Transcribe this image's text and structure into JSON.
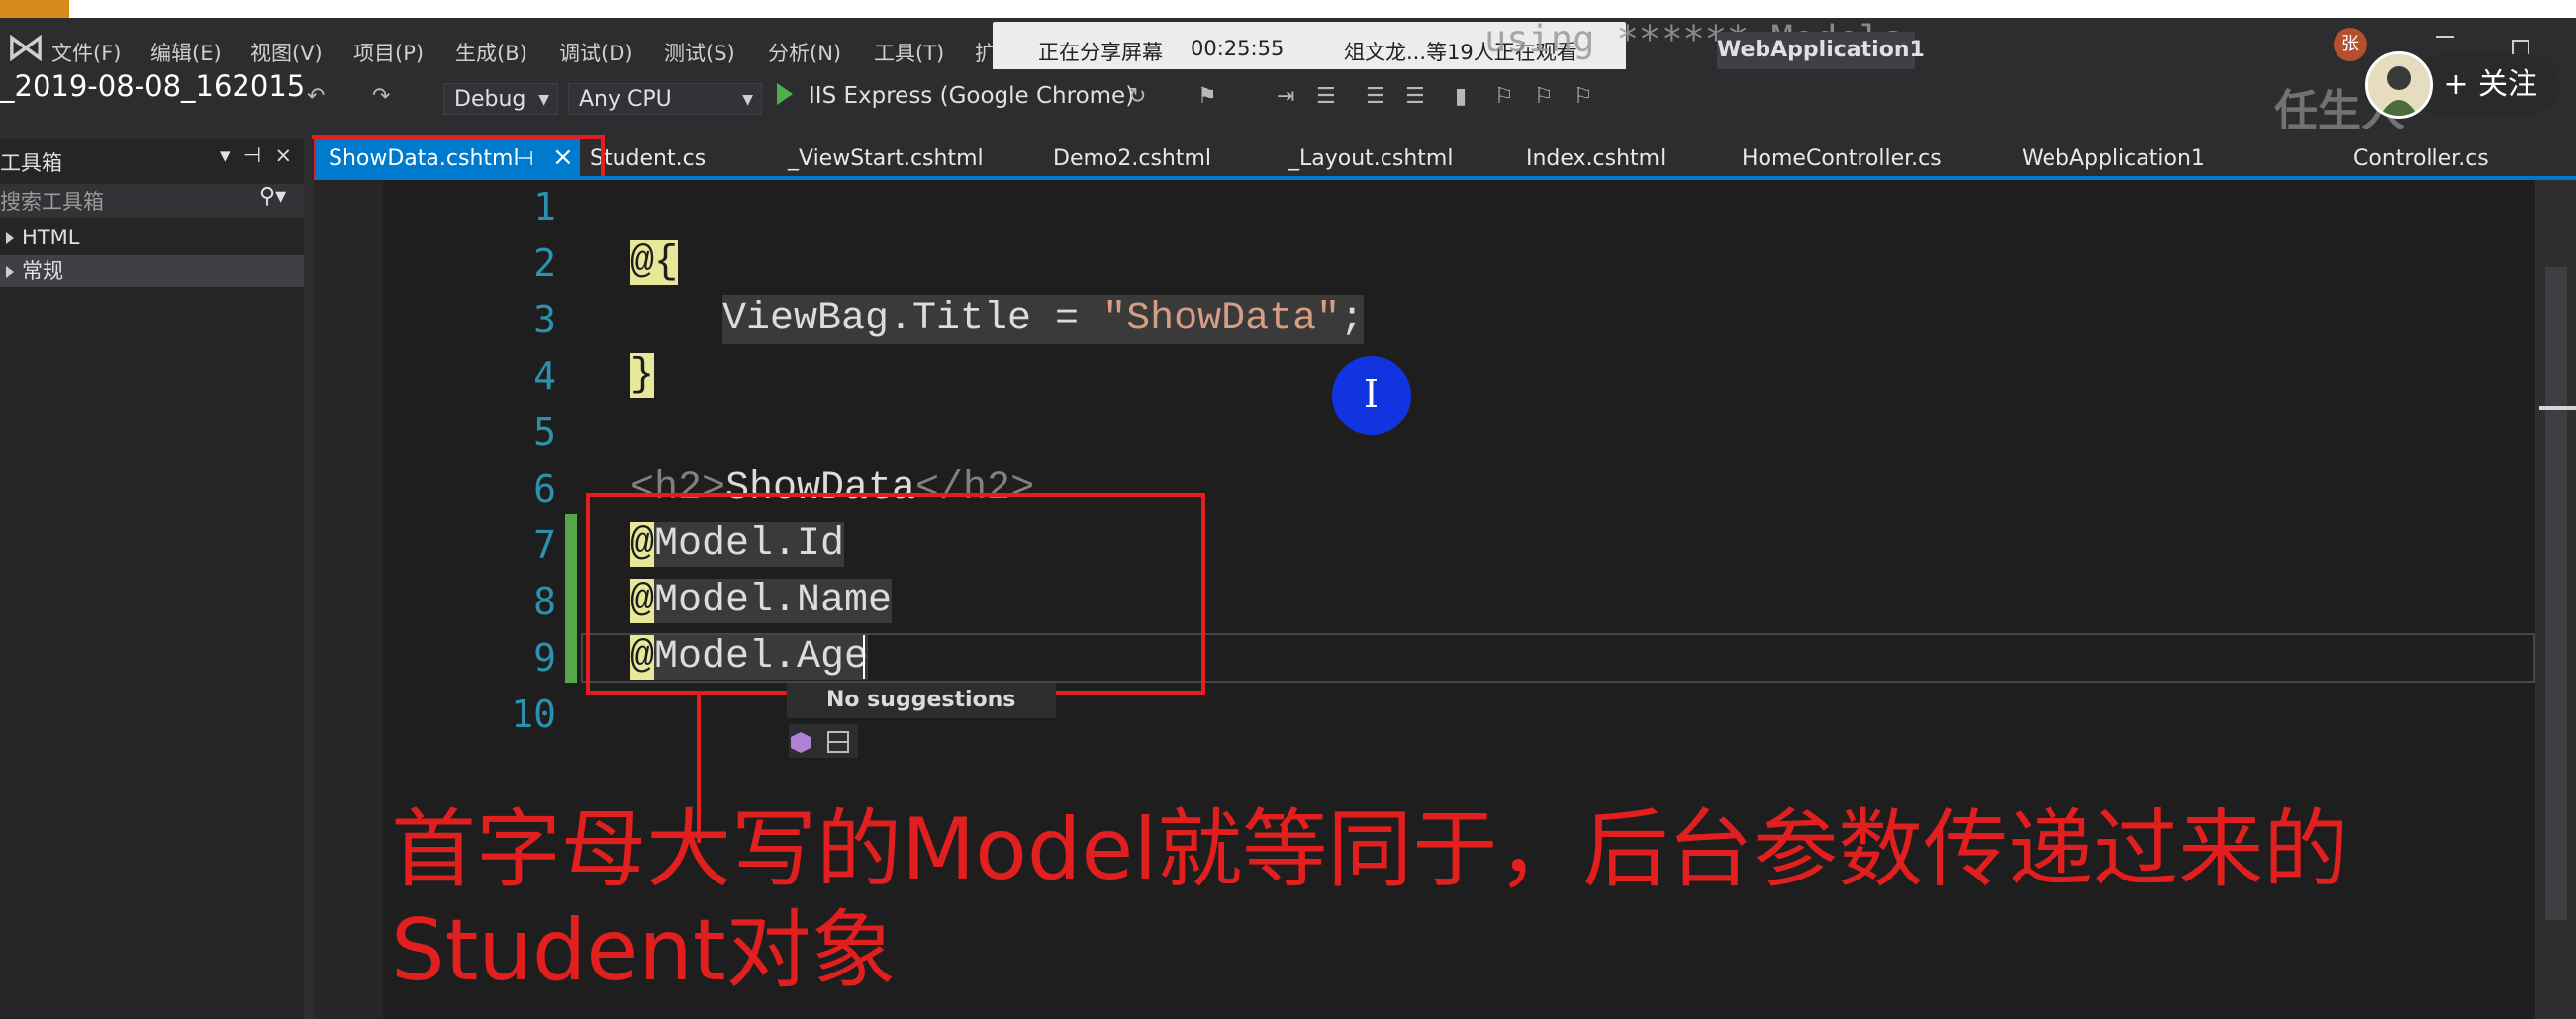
{
  "recording_title": "_2019-08-08_162015",
  "menu": [
    "文件(F)",
    "编辑(E)",
    "视图(V)",
    "项目(P)",
    "生成(B)",
    "调试(D)",
    "测试(S)",
    "分析(N)",
    "工具(T)",
    "扩"
  ],
  "share_banner": {
    "status": "正在分享屏幕",
    "time": "00:25:55",
    "viewers": "俎文龙...等19人正在观看"
  },
  "overlay_code_text": "using ****** Models",
  "window_title": "WebApplication1",
  "user_avatar": "张",
  "toolbar": {
    "config": "Debug",
    "platform": "Any CPU",
    "run_target": "IIS Express (Google Chrome)"
  },
  "follow": {
    "label": "+ 关注"
  },
  "watermark": "任生人",
  "tabs": {
    "active": "ShowData.cshtml",
    "others": [
      "Student.cs",
      "_ViewStart.cshtml",
      "Demo2.cshtml",
      "_Layout.cshtml",
      "Index.cshtml",
      "HomeController.cs",
      "WebApplication1",
      "Controller.cs"
    ]
  },
  "toolbox": {
    "title": "工具箱",
    "search_placeholder": "搜索工具箱",
    "groups": [
      "HTML",
      "常规"
    ]
  },
  "editor": {
    "line_numbers": [
      "1",
      "2",
      "3",
      "4",
      "5",
      "6",
      "7",
      "8",
      "9",
      "10"
    ],
    "line2_at": "@",
    "line2_brace": "{",
    "line3_code": "ViewBag.Title = ",
    "line3_string": "\"ShowData\"",
    "line3_semi": ";",
    "line4_brace": "}",
    "line6_open": "<h2>",
    "line6_text": "ShowData",
    "line6_close": "</h2>",
    "line7_at": "@",
    "line7_code": "Model.Id",
    "line8_at": "@",
    "line8_code": "Model.Name",
    "line9_at": "@",
    "line9_code": "Model.Age"
  },
  "intellisense": {
    "message": "No suggestions"
  },
  "annotation": {
    "line1": "首字母大写的Model就等同于，后台参数传递过来的",
    "line2": "Student对象"
  },
  "colors": {
    "accent": "#007acc",
    "annotation_red": "#e11f1f",
    "razor_highlight": "#e8e89a",
    "line_number": "#2b91af",
    "string": "#d69d85"
  }
}
